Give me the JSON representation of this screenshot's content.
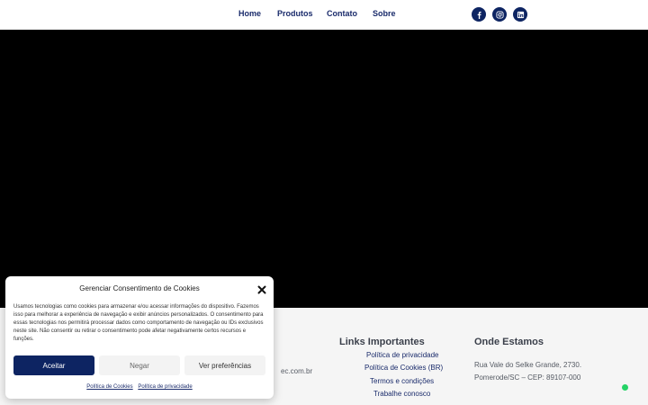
{
  "nav": {
    "items": [
      {
        "label": "Home"
      },
      {
        "label": "Produtos"
      },
      {
        "label": "Contato"
      },
      {
        "label": "Sobre"
      }
    ]
  },
  "social": {
    "icons": [
      "facebook-icon",
      "instagram-icon",
      "linkedin-icon"
    ],
    "color": "#0d2462"
  },
  "footer": {
    "partial_email": "ec.com.br",
    "links_title": "Links Importantes",
    "links": [
      "Política de privacidade",
      "Política de Cookies (BR)",
      "Termos e condições",
      "Trabalhe conosco"
    ],
    "location_title": "Onde Estamos",
    "address_line1": "Rua Vale do Selke Grande, 2730.",
    "address_line2": "Pomerode/SC  – CEP: 89107-000"
  },
  "cookie_modal": {
    "title": "Gerenciar Consentimento de Cookies",
    "body": "Usamos tecnologias como cookies para armazenar e/ou acessar informações do dispositivo. Fazemos isso para melhorar a experiência de navegação e exibir anúncios personalizados. O consentimento para essas tecnologias nos permitirá processar dados como comportamento de navegação ou IDs exclusivos neste site. Não consentir ou retirar o consentimento pode afetar negativamente certos recursos e funções.",
    "accept_label": "Aceitar",
    "deny_label": "Negar",
    "prefs_label": "Ver preferências",
    "cookie_policy_link": "Política de Cookies",
    "privacy_policy_link": "Política de privacidade"
  },
  "colors": {
    "brand": "#0d2462",
    "whatsapp": "#25d366"
  }
}
